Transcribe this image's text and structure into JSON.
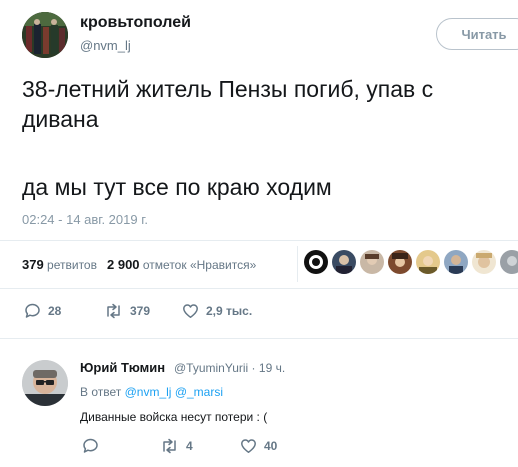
{
  "tweet": {
    "author_name": "кровьтополей",
    "author_handle": "@nvm_lj",
    "follow_label": "Читать",
    "text_line1": "38-летний житель Пензы погиб, упав с дивана",
    "text_line2": "да мы тут все по краю ходим",
    "timestamp": "02:24 - 14 авг. 2019 г.",
    "retweets_count": "379",
    "retweets_label": "ретвитов",
    "likes_count": "2 900",
    "likes_label": "отметок «Нравится»",
    "actions": {
      "reply_count": "28",
      "retweet_count": "379",
      "like_count": "2,9 тыс."
    }
  },
  "liked_by_avatars": [
    "face-1",
    "face-2",
    "face-3",
    "face-4",
    "face-5",
    "face-6",
    "face-7",
    "face-8"
  ],
  "reply": {
    "author_name": "Юрий Тюмин",
    "author_handle": "@TyuminYurii",
    "time": "19 ч.",
    "in_reply_prefix": "В ответ",
    "in_reply_handle1": "@nvm_lj",
    "in_reply_handle2": "@_marsi",
    "text": "Диванные войска несут потери : (",
    "actions": {
      "retweet_count": "4",
      "like_count": "40"
    }
  },
  "colors": {
    "link": "#1da1f2",
    "secondary_text": "#657786",
    "divider": "#e6ecf0"
  }
}
